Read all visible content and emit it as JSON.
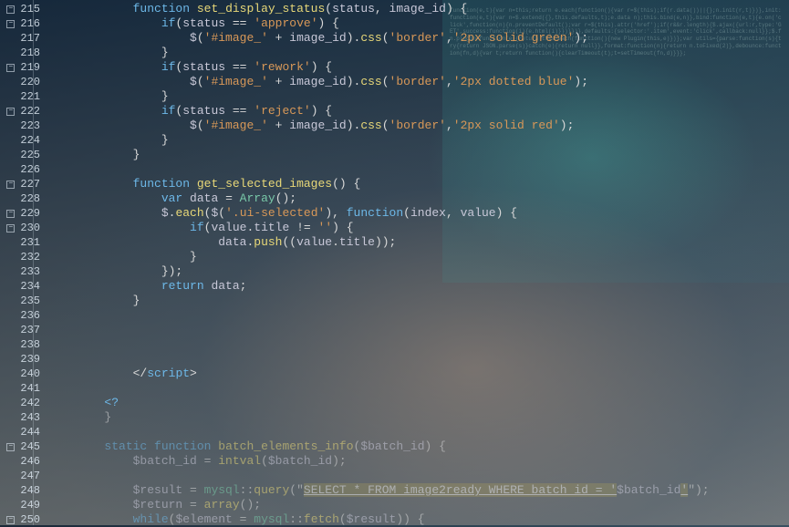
{
  "gutter": {
    "start": 215,
    "end": 250,
    "fold_markers": [
      215,
      216,
      219,
      222,
      227,
      229,
      230,
      245,
      250
    ]
  },
  "code_lines": [
    {
      "n": 215,
      "indent": 3,
      "t": [
        [
          "kw",
          "function"
        ],
        [
          "op",
          " "
        ],
        [
          "fn",
          "set_display_status"
        ],
        [
          "op",
          "("
        ],
        [
          "var",
          "status"
        ],
        [
          "op",
          ", "
        ],
        [
          "var",
          "image_id"
        ],
        [
          "op",
          ") {"
        ]
      ]
    },
    {
      "n": 216,
      "indent": 4,
      "t": [
        [
          "kw",
          "if"
        ],
        [
          "op",
          "("
        ],
        [
          "var",
          "status"
        ],
        [
          "op",
          " == "
        ],
        [
          "str",
          "'approve'"
        ],
        [
          "op",
          ") {"
        ]
      ]
    },
    {
      "n": 217,
      "indent": 5,
      "t": [
        [
          "var",
          "$"
        ],
        [
          "op",
          "("
        ],
        [
          "str",
          "'#image_'"
        ],
        [
          "op",
          " + "
        ],
        [
          "var",
          "image_id"
        ],
        [
          "op",
          ")."
        ],
        [
          "fn",
          "css"
        ],
        [
          "op",
          "("
        ],
        [
          "str",
          "'border'"
        ],
        [
          "op",
          ","
        ],
        [
          "str",
          "'2px solid green'"
        ],
        [
          "op",
          ");"
        ]
      ]
    },
    {
      "n": 218,
      "indent": 4,
      "t": [
        [
          "op",
          "}"
        ]
      ]
    },
    {
      "n": 219,
      "indent": 4,
      "t": [
        [
          "kw",
          "if"
        ],
        [
          "op",
          "("
        ],
        [
          "var",
          "status"
        ],
        [
          "op",
          " == "
        ],
        [
          "str",
          "'rework'"
        ],
        [
          "op",
          ") {"
        ]
      ]
    },
    {
      "n": 220,
      "indent": 5,
      "t": [
        [
          "var",
          "$"
        ],
        [
          "op",
          "("
        ],
        [
          "str",
          "'#image_'"
        ],
        [
          "op",
          " + "
        ],
        [
          "var",
          "image_id"
        ],
        [
          "op",
          ")."
        ],
        [
          "fn",
          "css"
        ],
        [
          "op",
          "("
        ],
        [
          "str",
          "'border'"
        ],
        [
          "op",
          ","
        ],
        [
          "str",
          "'2px dotted blue'"
        ],
        [
          "op",
          ");"
        ]
      ]
    },
    {
      "n": 221,
      "indent": 4,
      "t": [
        [
          "op",
          "}"
        ]
      ]
    },
    {
      "n": 222,
      "indent": 4,
      "t": [
        [
          "kw",
          "if"
        ],
        [
          "op",
          "("
        ],
        [
          "var",
          "status"
        ],
        [
          "op",
          " == "
        ],
        [
          "str",
          "'reject'"
        ],
        [
          "op",
          ") {"
        ]
      ]
    },
    {
      "n": 223,
      "indent": 5,
      "t": [
        [
          "var",
          "$"
        ],
        [
          "op",
          "("
        ],
        [
          "str",
          "'#image_'"
        ],
        [
          "op",
          " + "
        ],
        [
          "var",
          "image_id"
        ],
        [
          "op",
          ")."
        ],
        [
          "fn",
          "css"
        ],
        [
          "op",
          "("
        ],
        [
          "str",
          "'border'"
        ],
        [
          "op",
          ","
        ],
        [
          "str",
          "'2px solid red'"
        ],
        [
          "op",
          ");"
        ]
      ]
    },
    {
      "n": 224,
      "indent": 4,
      "t": [
        [
          "op",
          "}"
        ]
      ]
    },
    {
      "n": 225,
      "indent": 3,
      "t": [
        [
          "op",
          "}"
        ]
      ]
    },
    {
      "n": 226,
      "indent": 0,
      "t": []
    },
    {
      "n": 227,
      "indent": 3,
      "t": [
        [
          "kw",
          "function"
        ],
        [
          "op",
          " "
        ],
        [
          "fn",
          "get_selected_images"
        ],
        [
          "op",
          "() {"
        ]
      ]
    },
    {
      "n": 228,
      "indent": 4,
      "t": [
        [
          "kw",
          "var"
        ],
        [
          "op",
          " "
        ],
        [
          "var",
          "data"
        ],
        [
          "op",
          " = "
        ],
        [
          "type",
          "Array"
        ],
        [
          "op",
          "();"
        ]
      ]
    },
    {
      "n": 229,
      "indent": 4,
      "t": [
        [
          "var",
          "$"
        ],
        [
          "op",
          "."
        ],
        [
          "fn",
          "each"
        ],
        [
          "op",
          "("
        ],
        [
          "var",
          "$"
        ],
        [
          "op",
          "("
        ],
        [
          "str",
          "'.ui-selected'"
        ],
        [
          "op",
          "), "
        ],
        [
          "kw",
          "function"
        ],
        [
          "op",
          "("
        ],
        [
          "var",
          "index"
        ],
        [
          "op",
          ", "
        ],
        [
          "var",
          "value"
        ],
        [
          "op",
          ") {"
        ]
      ]
    },
    {
      "n": 230,
      "indent": 5,
      "t": [
        [
          "kw",
          "if"
        ],
        [
          "op",
          "("
        ],
        [
          "var",
          "value"
        ],
        [
          "op",
          "."
        ],
        [
          "var",
          "title"
        ],
        [
          "op",
          " != "
        ],
        [
          "str",
          "''"
        ],
        [
          "op",
          ") {"
        ]
      ]
    },
    {
      "n": 231,
      "indent": 6,
      "t": [
        [
          "var",
          "data"
        ],
        [
          "op",
          "."
        ],
        [
          "fn",
          "push"
        ],
        [
          "op",
          "(("
        ],
        [
          "var",
          "value"
        ],
        [
          "op",
          "."
        ],
        [
          "var",
          "title"
        ],
        [
          "op",
          "));"
        ]
      ]
    },
    {
      "n": 232,
      "indent": 5,
      "t": [
        [
          "op",
          "}"
        ]
      ]
    },
    {
      "n": 233,
      "indent": 4,
      "t": [
        [
          "op",
          "});"
        ]
      ]
    },
    {
      "n": 234,
      "indent": 4,
      "t": [
        [
          "kw",
          "return"
        ],
        [
          "op",
          " "
        ],
        [
          "var",
          "data"
        ],
        [
          "op",
          ";"
        ]
      ]
    },
    {
      "n": 235,
      "indent": 3,
      "t": [
        [
          "op",
          "}"
        ]
      ]
    },
    {
      "n": 236,
      "indent": 0,
      "t": []
    },
    {
      "n": 237,
      "indent": 0,
      "t": []
    },
    {
      "n": 238,
      "indent": 0,
      "t": []
    },
    {
      "n": 239,
      "indent": 0,
      "t": []
    },
    {
      "n": 240,
      "indent": 3,
      "t": [
        [
          "op",
          "</"
        ],
        [
          "kw",
          "script"
        ],
        [
          "op",
          ">"
        ]
      ]
    },
    {
      "n": 241,
      "indent": 0,
      "t": []
    },
    {
      "n": 242,
      "indent": 2,
      "t": [
        [
          "kw",
          "<?"
        ]
      ]
    },
    {
      "n": 243,
      "indent": 2,
      "t": [
        [
          "op",
          "}"
        ]
      ],
      "faded": true
    },
    {
      "n": 244,
      "indent": 0,
      "t": []
    },
    {
      "n": 245,
      "indent": 2,
      "t": [
        [
          "kw",
          "static function"
        ],
        [
          "op",
          " "
        ],
        [
          "fn",
          "batch_elements_info"
        ],
        [
          "op",
          "("
        ],
        [
          "var",
          "$batch_id"
        ],
        [
          "op",
          ") {"
        ]
      ],
      "faded": true
    },
    {
      "n": 246,
      "indent": 3,
      "t": [
        [
          "var",
          "$batch_id"
        ],
        [
          "op",
          " = "
        ],
        [
          "fn",
          "intval"
        ],
        [
          "op",
          "("
        ],
        [
          "var",
          "$batch_id"
        ],
        [
          "op",
          ");"
        ]
      ],
      "faded": true
    },
    {
      "n": 247,
      "indent": 0,
      "t": []
    },
    {
      "n": 248,
      "indent": 3,
      "t": [
        [
          "var",
          "$result"
        ],
        [
          "op",
          " = "
        ],
        [
          "type",
          "mysql"
        ],
        [
          "op",
          "::"
        ],
        [
          "fn",
          "query"
        ],
        [
          "op",
          "(\""
        ],
        [
          "hl",
          "SELECT * FROM image2ready WHERE batch_id = '"
        ],
        [
          "var",
          "$batch_id"
        ],
        [
          "hl",
          "'"
        ],
        [
          "op",
          "\");"
        ]
      ],
      "faded": true
    },
    {
      "n": 249,
      "indent": 3,
      "t": [
        [
          "var",
          "$return"
        ],
        [
          "op",
          " = "
        ],
        [
          "fn",
          "array"
        ],
        [
          "op",
          "();"
        ]
      ],
      "faded": true
    },
    {
      "n": 250,
      "indent": 3,
      "t": [
        [
          "kw",
          "while"
        ],
        [
          "op",
          "("
        ],
        [
          "var",
          "$element"
        ],
        [
          "op",
          " = "
        ],
        [
          "type",
          "mysql"
        ],
        [
          "op",
          "::"
        ],
        [
          "fn",
          "fetch"
        ],
        [
          "op",
          "("
        ],
        [
          "var",
          "$result"
        ],
        [
          "op",
          ")) {"
        ]
      ],
      "faded": true
    }
  ],
  "bg_noise": "function(e,t){var n=this;return e.each(function(){var r=$(this);if(r.data())||{};n.init(r,t)})},init:function(e,t){var n=$.extend({},this.defaults,t);e.data n);this.bind(e,n)},bind:function(e,t){e.on('click',function(n){n.preventDefault();var r=$(this).attr('href');if(r&&r.length){$.ajax({url:r,type:'GET',success:function(i){e.html(i)}})}})},defaults:{selector:'.item',event:'click',callback:null}};$.fn.plugin=function(e){return this.each(function(){new Plugin(this,e)})};var utils={parse:function(s){try{return JSON.parse(s)}catch(e){return null}},format:function(n){return n.toFixed(2)},debounce:function(fn,d){var t;return function(){clearTimeout(t);t=setTimeout(fn,d)}}};"
}
